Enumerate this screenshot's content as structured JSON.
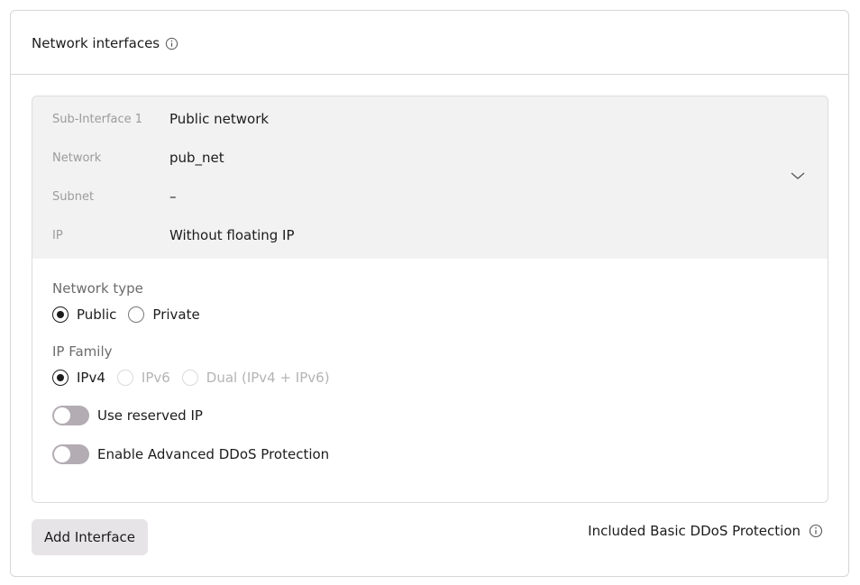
{
  "card": {
    "title": "Network interfaces"
  },
  "interface": {
    "summary": [
      {
        "key": "Sub-Interface 1",
        "value": "Public network"
      },
      {
        "key": "Network",
        "value": "pub_net"
      },
      {
        "key": "Subnet",
        "value": "–"
      },
      {
        "key": "IP",
        "value": "Without floating IP"
      }
    ],
    "network_type": {
      "label": "Network type",
      "options": [
        {
          "label": "Public",
          "checked": true,
          "disabled": false
        },
        {
          "label": "Private",
          "checked": false,
          "disabled": false
        }
      ]
    },
    "ip_family": {
      "label": "IP Family",
      "options": [
        {
          "label": "IPv4",
          "checked": true,
          "disabled": false
        },
        {
          "label": "IPv6",
          "checked": false,
          "disabled": true
        },
        {
          "label": "Dual (IPv4 + IPv6)",
          "checked": false,
          "disabled": true
        }
      ]
    },
    "toggles": [
      {
        "label": "Use reserved IP",
        "on": false
      },
      {
        "label": "Enable Advanced DDoS Protection",
        "on": false
      }
    ]
  },
  "footer": {
    "add_button": "Add Interface",
    "basic_ddos": "Included Basic DDoS Protection"
  },
  "colors": {
    "summary_bg": "#f2f2f2",
    "toggle_off": "#b3adb3",
    "button_bg": "#e7e4e7",
    "border": "#d6d6d6"
  },
  "icons": {
    "info": "info-circle-icon",
    "expand": "chevron-down-icon"
  }
}
